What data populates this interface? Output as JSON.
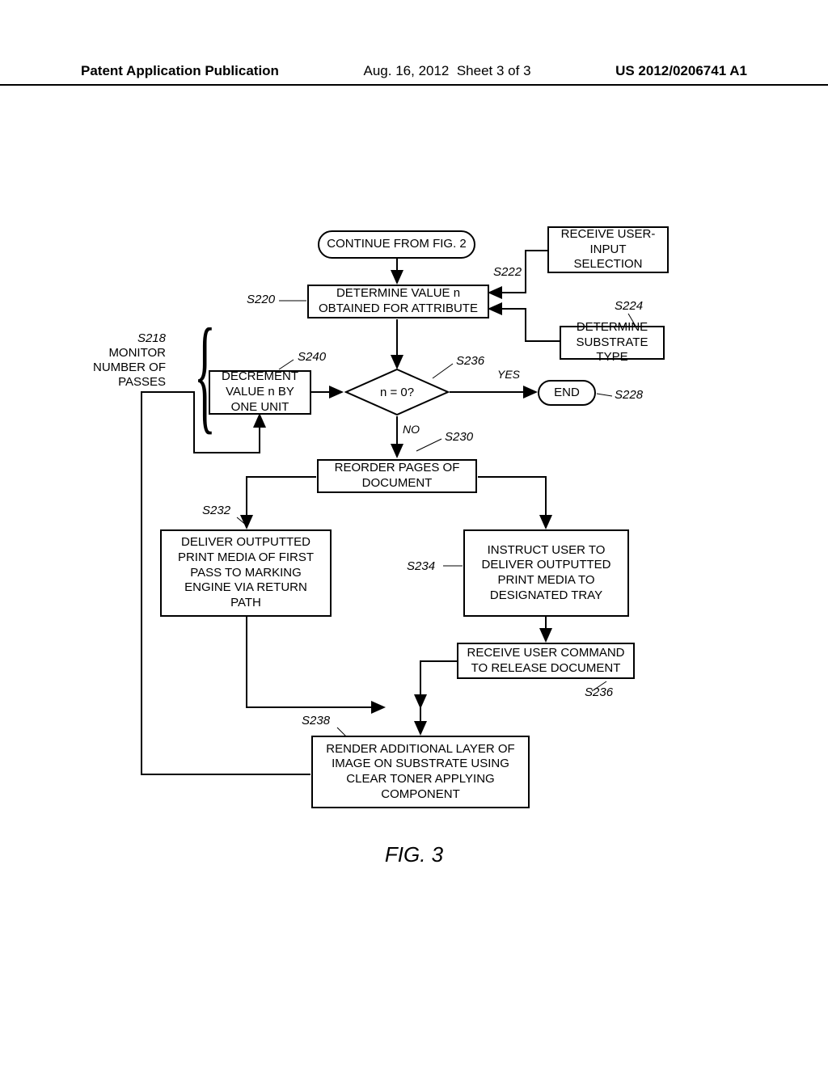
{
  "header": {
    "left": "Patent Application Publication",
    "date": "Aug. 16, 2012",
    "sheet": "Sheet 3 of 3",
    "pubno": "US 2012/0206741 A1"
  },
  "nodes": {
    "continue": "CONTINUE FROM FIG. 2",
    "user_input": "RECEIVE USER-INPUT SELECTION",
    "determine_n": "DETERMINE VALUE n OBTAINED FOR ATTRIBUTE",
    "determine_substrate": "DETERMINE SUBSTRATE TYPE",
    "decrement": "DECREMENT VALUE n BY ONE UNIT",
    "decision": "n = 0?",
    "end": "END",
    "reorder": "REORDER PAGES OF DOCUMENT",
    "deliver_return": "DELIVER OUTPUTTED PRINT MEDIA OF FIRST PASS TO MARKING ENGINE VIA RETURN PATH",
    "instruct_user": "INSTRUCT USER TO DELIVER OUTPUTTED PRINT MEDIA TO DESIGNATED TRAY",
    "receive_cmd": "RECEIVE USER COMMAND TO RELEASE DOCUMENT",
    "render": "RENDER ADDITIONAL LAYER OF IMAGE ON SUBSTRATE USING CLEAR TONER APPLYING COMPONENT"
  },
  "labels": {
    "s218": "S218",
    "monitor": "MONITOR NUMBER OF PASSES",
    "s220": "S220",
    "s222": "S222",
    "s224": "S224",
    "s228": "S228",
    "s230": "S230",
    "s232": "S232",
    "s234": "S234",
    "s236a": "S236",
    "s236b": "S236",
    "s238": "S238",
    "s240": "S240",
    "yes": "YES",
    "no": "NO"
  },
  "figure": "FIG. 3"
}
